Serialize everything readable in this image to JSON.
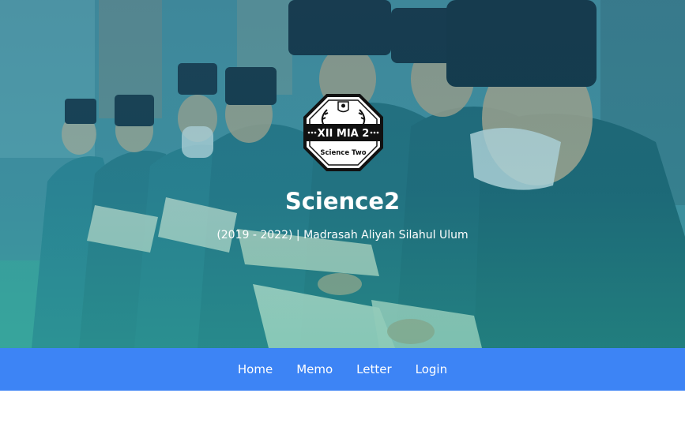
{
  "hero": {
    "logo": {
      "top_text": "XII MIA 2",
      "bottom_text": "Science Two",
      "icon": "school-emblem-icon"
    },
    "title": "Science2",
    "subtitle": "(2019 - 2022) | Madrasah Aliyah Silahul Ulum",
    "background_image": "students-reading-photo"
  },
  "nav": {
    "items": [
      {
        "label": "Home"
      },
      {
        "label": "Memo"
      },
      {
        "label": "Letter"
      },
      {
        "label": "Login"
      }
    ]
  },
  "colors": {
    "navbar": "#3d84f5",
    "hero_tint": "#2f8c9a",
    "text": "#ffffff"
  }
}
